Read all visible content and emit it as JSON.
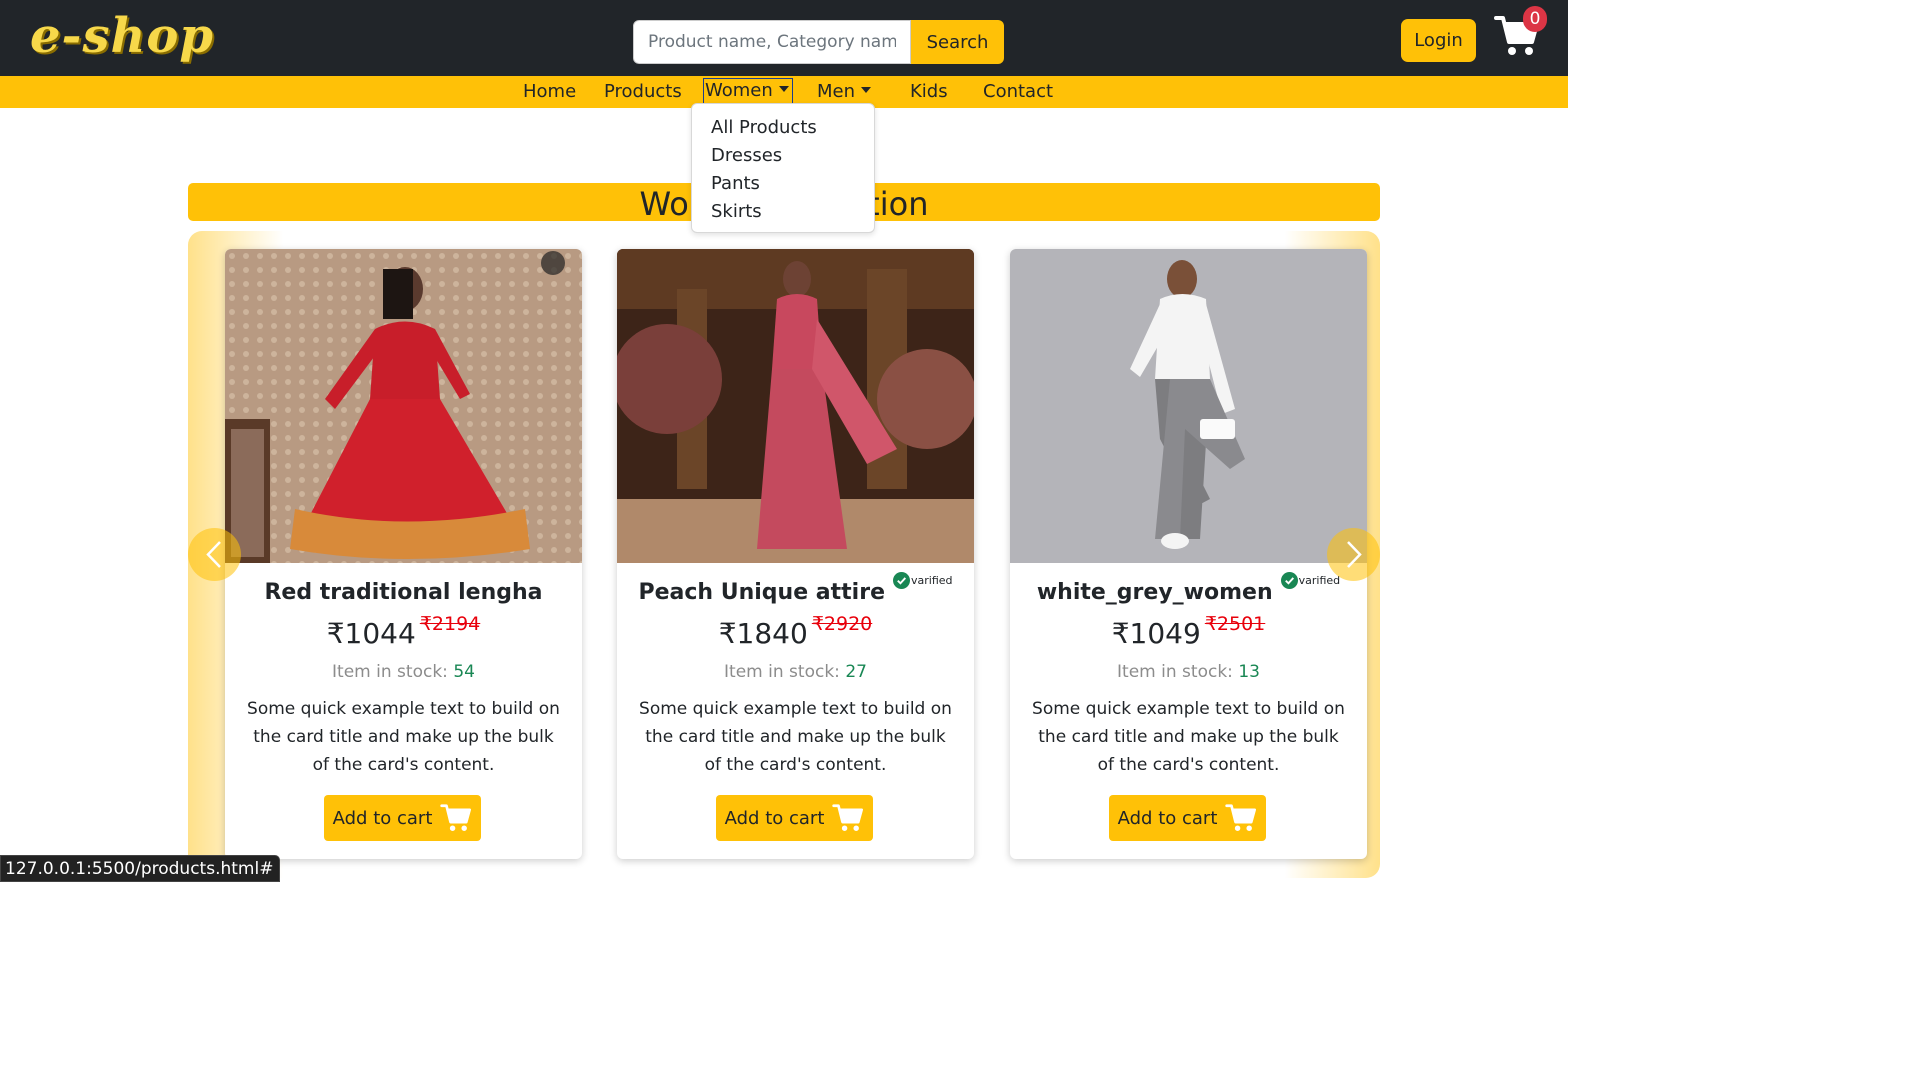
{
  "header": {
    "logo": "e-shop",
    "search_placeholder": "Product name, Category name",
    "search_button": "Search",
    "login": "Login",
    "cart_count": "0"
  },
  "nav": {
    "items": [
      "Home",
      "Products",
      "Women",
      "Men",
      "Kids",
      "Contact"
    ],
    "women_dropdown": [
      "All Products",
      "Dresses",
      "Pants",
      "Skirts"
    ]
  },
  "section": {
    "title": "Women Collection"
  },
  "products": [
    {
      "name": "Red traditional lengha",
      "verified": false,
      "price": "₹1044",
      "old_price": "₹2194",
      "stock_label": "Item in stock:",
      "stock": "54",
      "description": "Some quick example text to build on the card title and make up the bulk of the card's content.",
      "button": "Add to cart"
    },
    {
      "name": "Peach Unique attire",
      "verified": true,
      "verified_label": "varified",
      "price": "₹1840",
      "old_price": "₹2920",
      "stock_label": "Item in stock:",
      "stock": "27",
      "description": "Some quick example text to build on the card title and make up the bulk of the card's content.",
      "button": "Add to cart"
    },
    {
      "name": "white_grey_women",
      "verified": true,
      "verified_label": "varified",
      "price": "₹1049",
      "old_price": "₹2501",
      "stock_label": "Item in stock:",
      "stock": "13",
      "description": "Some quick example text to build on the card title and make up the bulk of the card's content.",
      "button": "Add to cart"
    }
  ],
  "status_url": "127.0.0.1:5500/products.html#",
  "colors": {
    "accent": "#ffc107",
    "header_bg": "#212529",
    "badge": "#dc3545",
    "stock": "#198754",
    "old_price": "#e8000b"
  }
}
